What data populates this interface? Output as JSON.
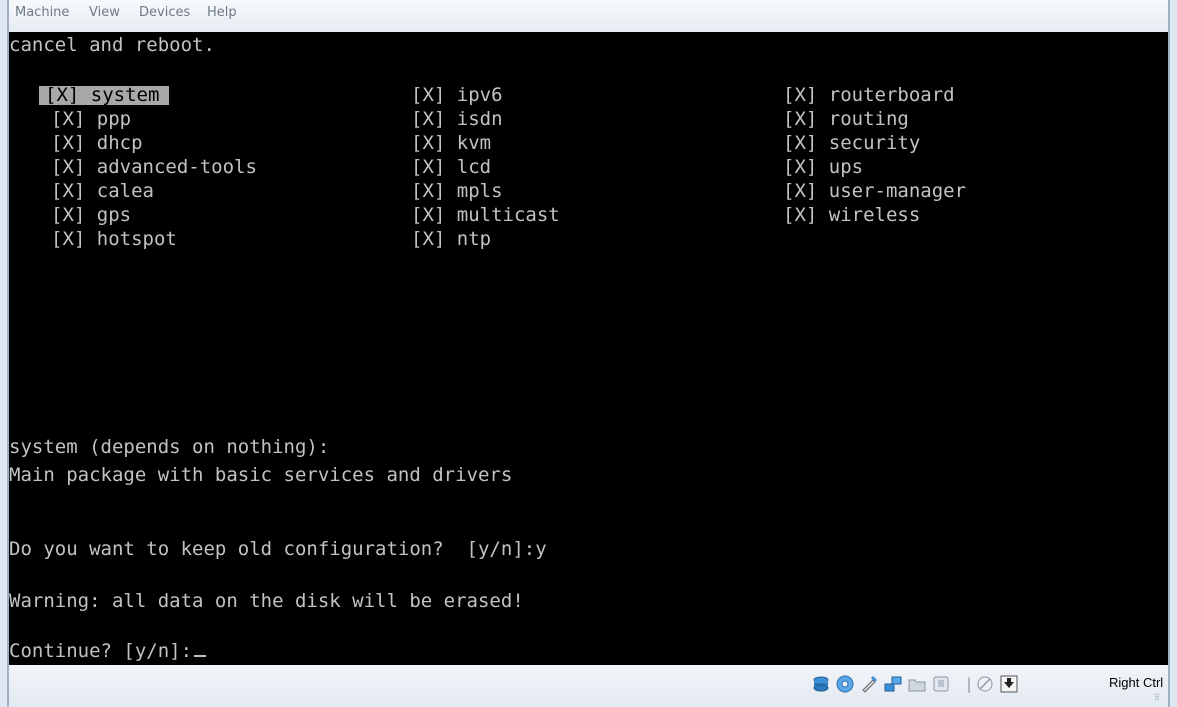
{
  "menubar": {
    "items": [
      "Machine",
      "View",
      "Devices",
      "Help"
    ]
  },
  "console": {
    "header": "cancel and reboot.",
    "packages": {
      "col1": [
        "[X] system",
        "[X] ppp",
        "[X] dhcp",
        "[X] advanced-tools",
        "[X] calea",
        "[X] gps",
        "[X] hotspot"
      ],
      "col2": [
        "[X] ipv6",
        "[X] isdn",
        "[X] kvm",
        "[X] lcd",
        "[X] mpls",
        "[X] multicast",
        "[X] ntp"
      ],
      "col3": [
        "[X] routerboard",
        "[X] routing",
        "[X] security",
        "[X] ups",
        "[X] user-manager",
        "[X] wireless"
      ]
    },
    "description_title": "system (depends on nothing):",
    "description_body": "Main package with basic services and drivers",
    "keep_config_prompt": "Do you want to keep old configuration?  [y/n]:y",
    "warning": "Warning: all data on the disk will be erased!",
    "continue_prompt": "Continue? [y/n]:"
  },
  "statusbar": {
    "icons": [
      "hard-disk-icon",
      "cd-dvd-icon",
      "usb-icon",
      "network-icon",
      "shared-folders-icon",
      "virtualization-icon",
      "mouse-integration-icon",
      "host-key-arrow-icon"
    ],
    "host_key_label": "Right Ctrl"
  }
}
